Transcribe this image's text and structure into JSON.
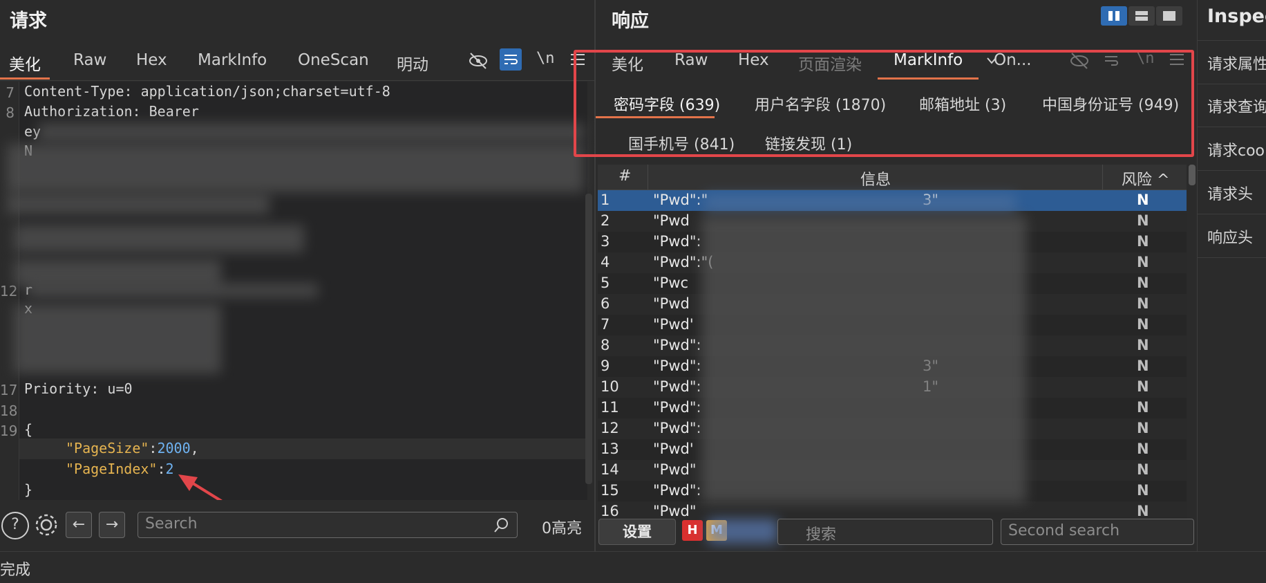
{
  "request": {
    "title": "请求",
    "tabs": [
      "美化",
      "Raw",
      "Hex",
      "MarkInfo",
      "OneScan",
      "明动"
    ],
    "icons": {
      "eye_off": "eye-off-icon",
      "wrap": "wrap-icon",
      "newline": "\\n",
      "menu": "menu-icon"
    },
    "lines": [
      {
        "n": "7",
        "text": "Content-Type: application/json;charset=utf-8"
      },
      {
        "n": "8",
        "text": "Authorization: Bearer"
      },
      {
        "n": "",
        "text": "ey"
      },
      {
        "n": "",
        "text": "N"
      },
      {
        "n": "12",
        "text": "r"
      },
      {
        "n": "",
        "text": "x"
      }
    ],
    "priority_line": {
      "n": "17",
      "text": "Priority: u=0"
    },
    "ln18": "18",
    "ln19": "19",
    "brace_open": "{",
    "brace_close": "}",
    "json_key1": "\"PageSize\"",
    "json_val1": "2000",
    "json_key2": "\"PageIndex\"",
    "json_val2": "2",
    "colon": ":",
    "comma": ",",
    "search_placeholder": "Search",
    "highlight_count": "0高亮",
    "help": "?",
    "back": "←",
    "forward": "→"
  },
  "response": {
    "title": "响应",
    "tabs": [
      "美化",
      "Raw",
      "Hex",
      "页面渲染",
      "MarkInfo",
      "On..."
    ],
    "subtabs": [
      "密码字段 (639)",
      "用户名字段 (1870)",
      "邮箱地址 (3)",
      "中国身份证号 (949)",
      "国手机号 (841)",
      "链接发现 (1)"
    ],
    "table": {
      "col_num": "#",
      "col_info": "信息",
      "col_risk": "风险 ^",
      "rows": [
        {
          "n": "1",
          "info": "\"Pwd\":\"",
          "tail": "3\"",
          "risk": "N"
        },
        {
          "n": "2",
          "info": "\"Pwd",
          "tail": "",
          "risk": "N"
        },
        {
          "n": "3",
          "info": "\"Pwd\":",
          "tail": "",
          "risk": "N"
        },
        {
          "n": "4",
          "info": "\"Pwd\":\"(",
          "tail": "",
          "risk": "N"
        },
        {
          "n": "5",
          "info": "\"Pwc",
          "tail": "",
          "risk": "N"
        },
        {
          "n": "6",
          "info": "\"Pwd",
          "tail": "",
          "risk": "N"
        },
        {
          "n": "7",
          "info": "\"Pwd'",
          "tail": "",
          "risk": "N"
        },
        {
          "n": "8",
          "info": "\"Pwd\":",
          "tail": "",
          "risk": "N"
        },
        {
          "n": "9",
          "info": "\"Pwd\":",
          "tail": "3\"",
          "risk": "N"
        },
        {
          "n": "10",
          "info": "\"Pwd\":",
          "tail": "1\"",
          "risk": "N"
        },
        {
          "n": "11",
          "info": "\"Pwd\":",
          "tail": "",
          "risk": "N"
        },
        {
          "n": "12",
          "info": "\"Pwd\":",
          "tail": "",
          "risk": "N"
        },
        {
          "n": "13",
          "info": "\"Pwd'",
          "tail": "",
          "risk": "N"
        },
        {
          "n": "14",
          "info": "\"Pwd\"",
          "tail": "",
          "risk": "N"
        },
        {
          "n": "15",
          "info": "\"Pwd\":",
          "tail": "",
          "risk": "N"
        },
        {
          "n": "16",
          "info": "\"Pwd\"",
          "tail": "",
          "risk": "N"
        }
      ]
    },
    "settings_label": "设置",
    "tags": [
      "H",
      "M"
    ],
    "search_placeholder": "搜索",
    "second_search_placeholder": "Second search"
  },
  "sidebar": {
    "title": "Inspec",
    "items": [
      "请求属性",
      "请求查询",
      "请求coo",
      "请求头",
      "响应头"
    ]
  },
  "status": "完成",
  "colors": {
    "accent": "#e3734a",
    "selected_row": "#2d5c94",
    "highlight_box": "#e2464a",
    "layout_active": "#2f6cb3"
  }
}
